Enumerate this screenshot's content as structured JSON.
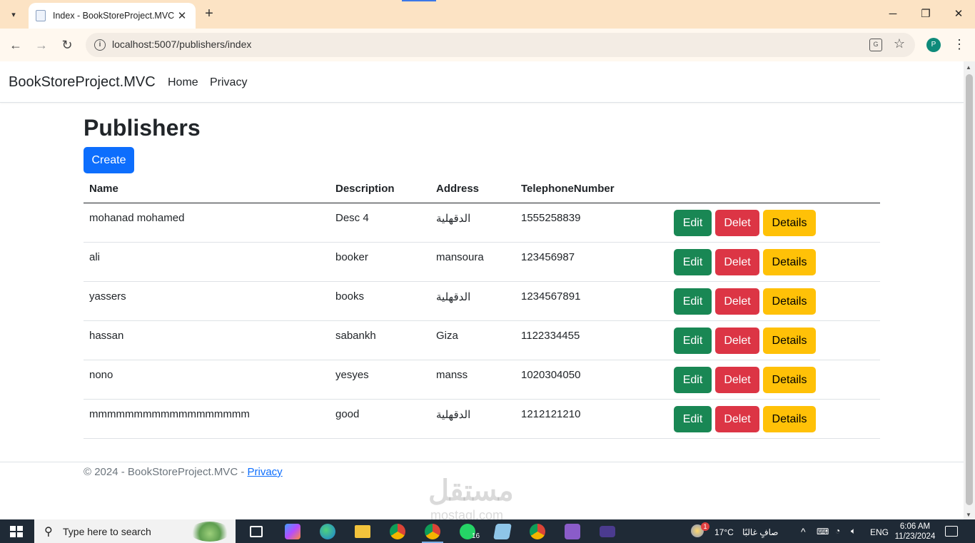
{
  "browser": {
    "tab_title": "Index - BookStoreProject.MVC",
    "tab_close": "✕",
    "new_tab": "+",
    "url": "localhost:5007/publishers/index",
    "profile_initial": "P"
  },
  "site": {
    "brand": "BookStoreProject.MVC",
    "nav": [
      "Home",
      "Privacy"
    ]
  },
  "page": {
    "title": "Publishers",
    "create_label": "Create",
    "columns": [
      "Name",
      "Description",
      "Address",
      "TelephoneNumber"
    ],
    "rows": [
      {
        "name": "mohanad mohamed",
        "description": "Desc 4",
        "address": "الدقهلية",
        "phone": "1555258839"
      },
      {
        "name": "ali",
        "description": "booker",
        "address": "mansoura",
        "phone": "123456987"
      },
      {
        "name": "yassers",
        "description": "books",
        "address": "الدقهلية",
        "phone": "1234567891"
      },
      {
        "name": "hassan",
        "description": "sabankh",
        "address": "Giza",
        "phone": "1122334455"
      },
      {
        "name": "nono",
        "description": "yesyes",
        "address": "manss",
        "phone": "1020304050"
      },
      {
        "name": "mmmmmmmmmmmmmmmmmm",
        "description": "good",
        "address": "الدقهلية",
        "phone": "1212121210"
      }
    ],
    "actions": {
      "edit": "Edit",
      "delete": "Delet",
      "details": "Details"
    },
    "colors": {
      "primary": "#0d6efd",
      "success": "#198754",
      "danger": "#dc3545",
      "warning": "#ffc107"
    }
  },
  "footer": {
    "copyright": "© 2024 - BookStoreProject.MVC - ",
    "privacy_link": "Privacy"
  },
  "watermark": {
    "arabic": "مستقل",
    "latin": "mostaql.com"
  },
  "taskbar": {
    "search_placeholder": "Type here to search",
    "weather": "17°C",
    "weather_desc": "صافٍ غالبًا",
    "language": "ENG",
    "time": "6:06 AM",
    "date": "11/23/2024",
    "whatsapp_badge": "16",
    "weather_badge": "1"
  }
}
